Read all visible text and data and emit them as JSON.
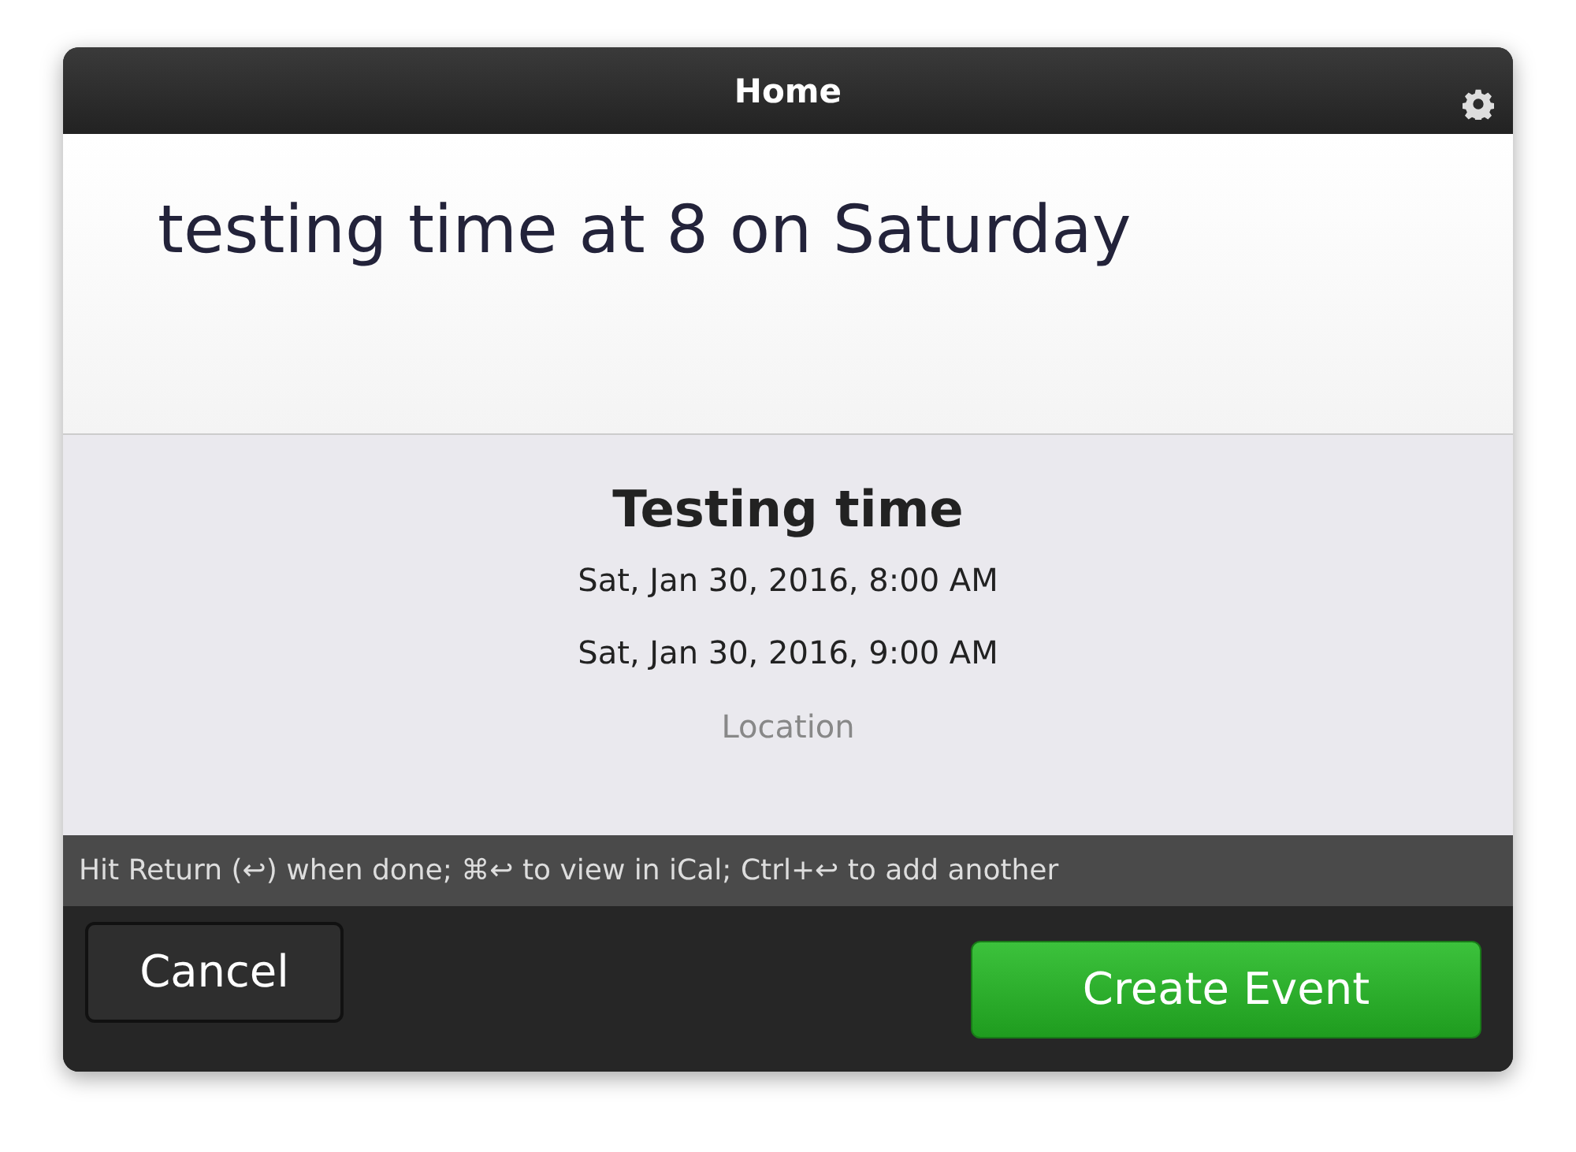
{
  "window": {
    "title": "Home"
  },
  "input": {
    "value": "testing time at 8 on Saturday"
  },
  "preview": {
    "title": "Testing time",
    "start": "Sat, Jan 30, 2016, 8:00 AM",
    "end": "Sat, Jan 30, 2016, 9:00 AM",
    "location": {
      "placeholder": "Location"
    }
  },
  "hint": "Hit Return (↩) when done; ⌘↩ to view in iCal; Ctrl+↩ to add another",
  "buttons": [
    {
      "label": "Cancel",
      "kind": "secondary"
    },
    {
      "label": "Create Event",
      "kind": "primary"
    }
  ]
}
